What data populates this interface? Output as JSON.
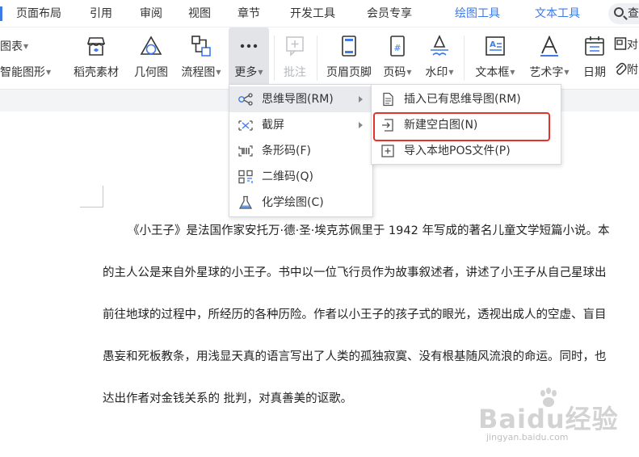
{
  "menubar": {
    "items": [
      "页面布局",
      "引用",
      "审阅",
      "视图",
      "章节",
      "开发工具",
      "会员专享"
    ],
    "context_tabs": [
      "绘图工具",
      "文本工具"
    ],
    "search_label": "查"
  },
  "ribbon": {
    "left_top": "图表",
    "left_bottom": "智能图形",
    "buttons": {
      "daoke": "稻壳素材",
      "geometry": "几何图",
      "flowchart": "流程图",
      "more": "更多",
      "annotate": "批注",
      "header_footer": "页眉页脚",
      "page_number": "页码",
      "watermark": "水印",
      "textbox": "文本框",
      "wordart": "艺术字",
      "date": "日期"
    },
    "right_top": "对",
    "right_bottom": "附"
  },
  "menu_more": {
    "items": [
      {
        "label": "思维导图(RM)",
        "has_submenu": true
      },
      {
        "label": "截屏",
        "has_submenu": true
      },
      {
        "label": "条形码(F)",
        "has_submenu": false
      },
      {
        "label": "二维码(Q)",
        "has_submenu": false
      },
      {
        "label": "化学绘图(C)",
        "has_submenu": false
      }
    ]
  },
  "menu_mindmap": {
    "items": [
      {
        "label": "插入已有思维导图(RM)"
      },
      {
        "label": "新建空白图(N)"
      },
      {
        "label": "导入本地POS文件(P)"
      }
    ],
    "highlight_color": "#e6322d"
  },
  "document": {
    "paragraph_lines": [
      "《小王子》是法国作家安托万·德·圣·埃克苏佩里于 1942 年写成的著名儿童文学短篇小说。本",
      "的主人公是来自外星球的小王子。书中以一位飞行员作为故事叙述者，讲述了小王子从自己星球出",
      "前往地球的过程中，所经历的各种历险。作者以小王子的孩子式的眼光，透视出成人的空虚、盲目",
      "愚妄和死板教条，用浅显天真的语言写出了人类的孤独寂寞、没有根基随风流浪的命运。同时，也",
      "达出作者对金钱关系的      批判，对真善美的讴歌。"
    ]
  },
  "watermark": {
    "main": "Baidu经验",
    "url": "jingyan.baidu.com"
  },
  "colors": {
    "accent": "#3f7ae6",
    "menu_hover": "#e8eaee",
    "ribbon_active": "#e2e4e8"
  }
}
